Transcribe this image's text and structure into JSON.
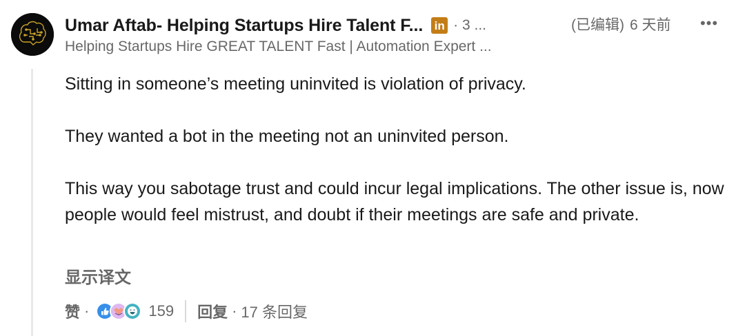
{
  "comment": {
    "author_name": "Umar Aftab- Helping Startups Hire Talent F...",
    "premium_badge": "in",
    "degree": "· 3 ...",
    "edited_label": "(已编辑)",
    "time_ago": "6 天前",
    "more_label": "•••",
    "headline": "Helping Startups Hire GREAT TALENT Fast | Automation Expert ...",
    "paragraphs": [
      "Sitting in someone’s meeting uninvited is violation of privacy.",
      "They wanted a bot in the meeting not an uninvited person.",
      "This way you sabotage trust and could incur legal implications. The other issue is, now people would feel mistrust, and doubt if their meetings are safe and private."
    ],
    "translate_label": "显示译文"
  },
  "actions": {
    "like_label": "赞",
    "dot": "·",
    "reaction_icons": [
      "like-icon",
      "support-icon",
      "funny-icon"
    ],
    "reaction_count": "159",
    "reply_label": "回复",
    "reply_count_label": "17 条回复"
  },
  "colors": {
    "badge": "#c37d16",
    "like": "#378fe9",
    "support": "#dfb8f0",
    "funny": "#44b3c2",
    "thread_line": "#e8e8e8"
  }
}
